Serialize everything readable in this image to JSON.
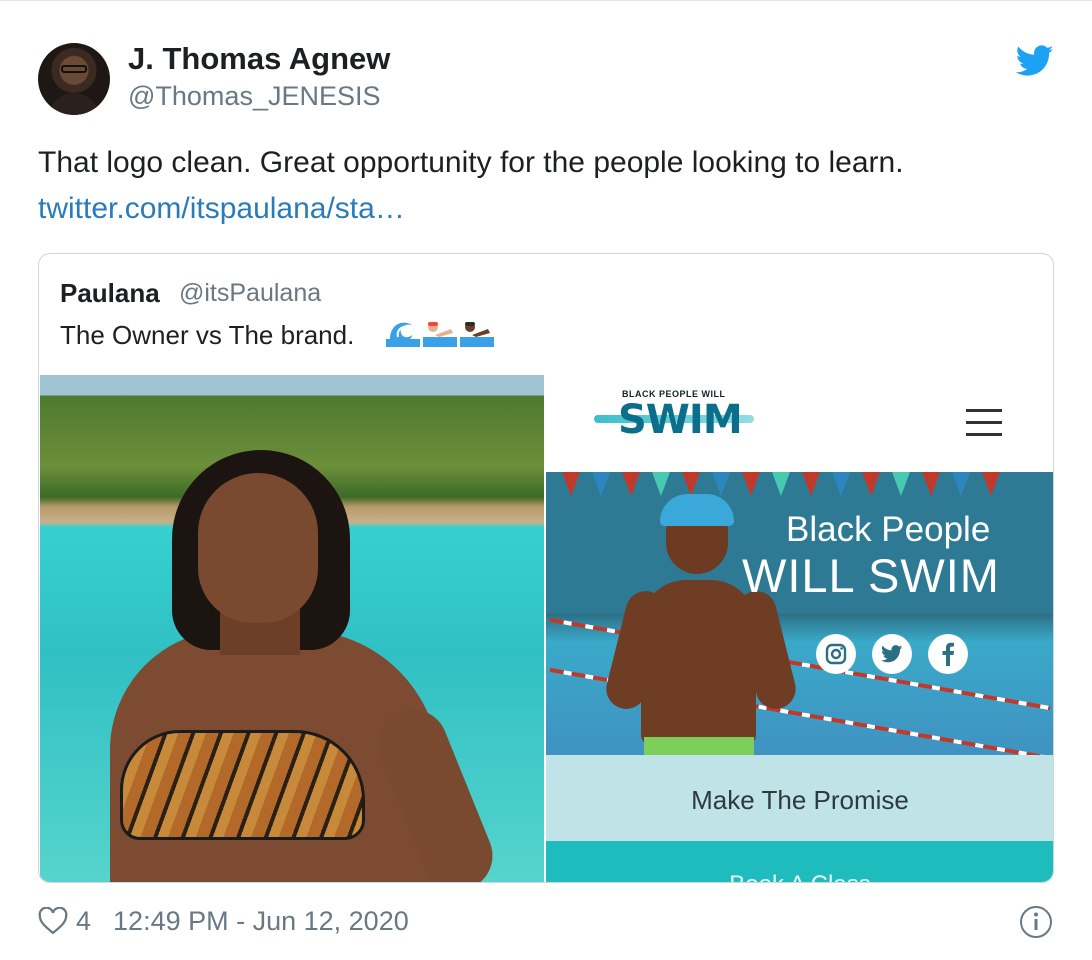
{
  "tweet": {
    "author_name": "J. Thomas Agnew",
    "author_handle": "@Thomas_JENESIS",
    "text": "That logo clean. Great opportunity for the people looking to learn.",
    "link": "twitter.com/itspaulana/sta…",
    "likes": "4",
    "timestamp": "12:49 PM - Jun 12, 2020"
  },
  "quote": {
    "author_name": "Paulana",
    "author_handle": "@itsPaulana",
    "text": "The Owner vs The brand.",
    "emojis": [
      "water-wave-icon",
      "person-swimming-light-icon",
      "person-swimming-dark-icon"
    ]
  },
  "app_screenshot": {
    "logo_small": "BLACK PEOPLE WILL",
    "logo_big": "SWIM",
    "hero_line1": "Black People",
    "hero_line2": "WILL SWIM",
    "social_icons": [
      "instagram-icon",
      "twitter-icon",
      "facebook-icon"
    ],
    "promise_button": "Make The Promise",
    "book_button": "Book A Class"
  },
  "colors": {
    "link": "#2b7bb9",
    "twitter_blue": "#1da1f2",
    "muted": "#697882",
    "promise_bg": "#bfe3e7",
    "book_bg": "#1ebcbc"
  }
}
